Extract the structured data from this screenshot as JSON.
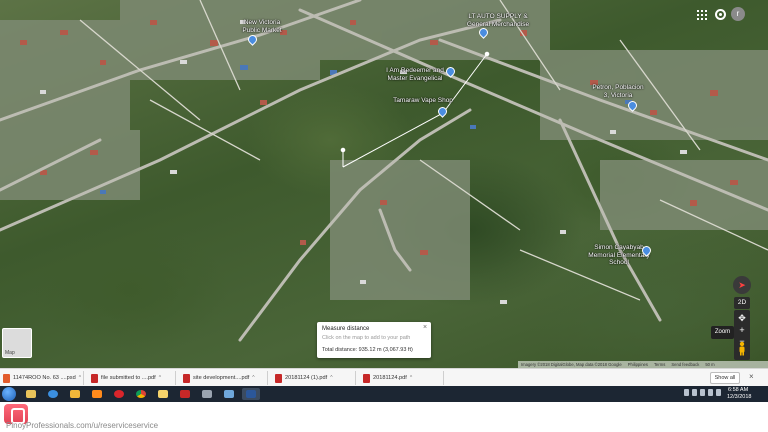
{
  "map": {
    "places": [
      {
        "name": "New Victoria Public Market"
      },
      {
        "name": "LT AUTO SUPPLY & General Merchandise"
      },
      {
        "name": "I Am Redeemer and Master Evangelical"
      },
      {
        "name": "Tamaraw Vape Shop"
      },
      {
        "name": "Petron, Poblacion 3, Victoria"
      },
      {
        "name": "Simon Cayabyab Memorial Elementary School"
      }
    ],
    "layer_thumb_label": "Map",
    "account_initial": "r",
    "controls": {
      "view_2d": "2D",
      "zoom_in": "+",
      "zoom_out": "−",
      "zoom_tooltip": "Zoom"
    },
    "measure": {
      "title": "Measure distance",
      "hint": "Click on the map to add to your path",
      "total": "Total distance: 935.12 m (3,067.93 ft)",
      "close": "×"
    },
    "attribution": [
      "Imagery ©2018 DigitalGlobe, Map data ©2018 Google",
      "Philippines",
      "Terms",
      "Send feedback",
      "50 m"
    ]
  },
  "downloads": {
    "items": [
      {
        "name": "11474ROO No. 63 ....psd",
        "type": "pdf"
      },
      {
        "name": "file submitted to ....pdf",
        "type": "pdf"
      },
      {
        "name": "site development....pdf",
        "type": "pdf"
      },
      {
        "name": "20181124 (1).pdf",
        "type": "pdf"
      },
      {
        "name": "20181124.pdf",
        "type": "pdf"
      }
    ],
    "show_all": "Show all",
    "close": "×"
  },
  "taskbar": {
    "time": "6:58 AM",
    "date": "12/3/2018"
  },
  "footer": {
    "watermark": "PinoyProfessionals.com/u/reserviceservice"
  }
}
